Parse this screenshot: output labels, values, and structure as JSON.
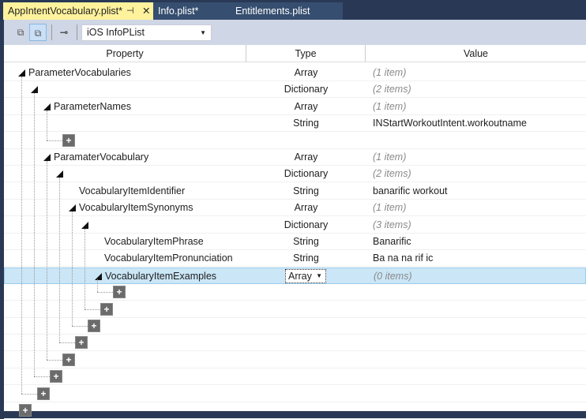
{
  "tabs": [
    {
      "label": "AppIntentVocabulary.plist*",
      "active": true
    },
    {
      "label": "Info.plist*"
    },
    {
      "label": "Entitlements.plist"
    }
  ],
  "tab_icons": {
    "pin": "⊣",
    "close": "✕"
  },
  "toolbar": {
    "combo_value": "iOS InfoPList"
  },
  "columns": {
    "property": "Property",
    "type": "Type",
    "value": "Value"
  },
  "rows": [
    {
      "level": 0,
      "key": "ParameterVocabularies",
      "type": "Array",
      "value": "(1 item)",
      "count": true,
      "expand": true
    },
    {
      "level": 1,
      "key": "",
      "type": "Dictionary",
      "value": "(2 items)",
      "count": true,
      "expand": true
    },
    {
      "level": 2,
      "key": "ParameterNames",
      "type": "Array",
      "value": "(1 item)",
      "count": true,
      "expand": true
    },
    {
      "level": 3,
      "key": "",
      "type": "String",
      "value": "INStartWorkoutIntent.workoutname"
    },
    {
      "add": true,
      "level": 3
    },
    {
      "level": 2,
      "key": "ParamaterVocabulary",
      "type": "Array",
      "value": "(1 item)",
      "count": true,
      "expand": true
    },
    {
      "level": 3,
      "key": "",
      "type": "Dictionary",
      "value": "(2 items)",
      "count": true,
      "expand": true
    },
    {
      "level": 4,
      "key": "VocabularyItemIdentifier",
      "type": "String",
      "value": "banarific workout"
    },
    {
      "level": 4,
      "key": "VocabularyItemSynonyms",
      "type": "Array",
      "value": "(1 item)",
      "count": true,
      "expand": true
    },
    {
      "level": 5,
      "key": "",
      "type": "Dictionary",
      "value": "(3 items)",
      "count": true,
      "expand": true
    },
    {
      "level": 6,
      "key": "VocabularyItemPhrase",
      "type": "String",
      "value": "Banarific"
    },
    {
      "level": 6,
      "key": "VocabularyItemPronunciation",
      "type": "String",
      "value": "Ba na na rif ic"
    },
    {
      "level": 6,
      "key": "VocabularyItemExamples",
      "type": "Array",
      "value": "(0 items)",
      "count": true,
      "expand": true,
      "selected": true
    },
    {
      "add": true,
      "level": 7
    },
    {
      "add": true,
      "level": 6
    },
    {
      "add": true,
      "level": 5
    },
    {
      "add": true,
      "level": 4
    },
    {
      "add": true,
      "level": 3
    },
    {
      "add": true,
      "level": 2
    },
    {
      "add": true,
      "level": 1
    },
    {
      "add": true,
      "level": 0
    }
  ]
}
